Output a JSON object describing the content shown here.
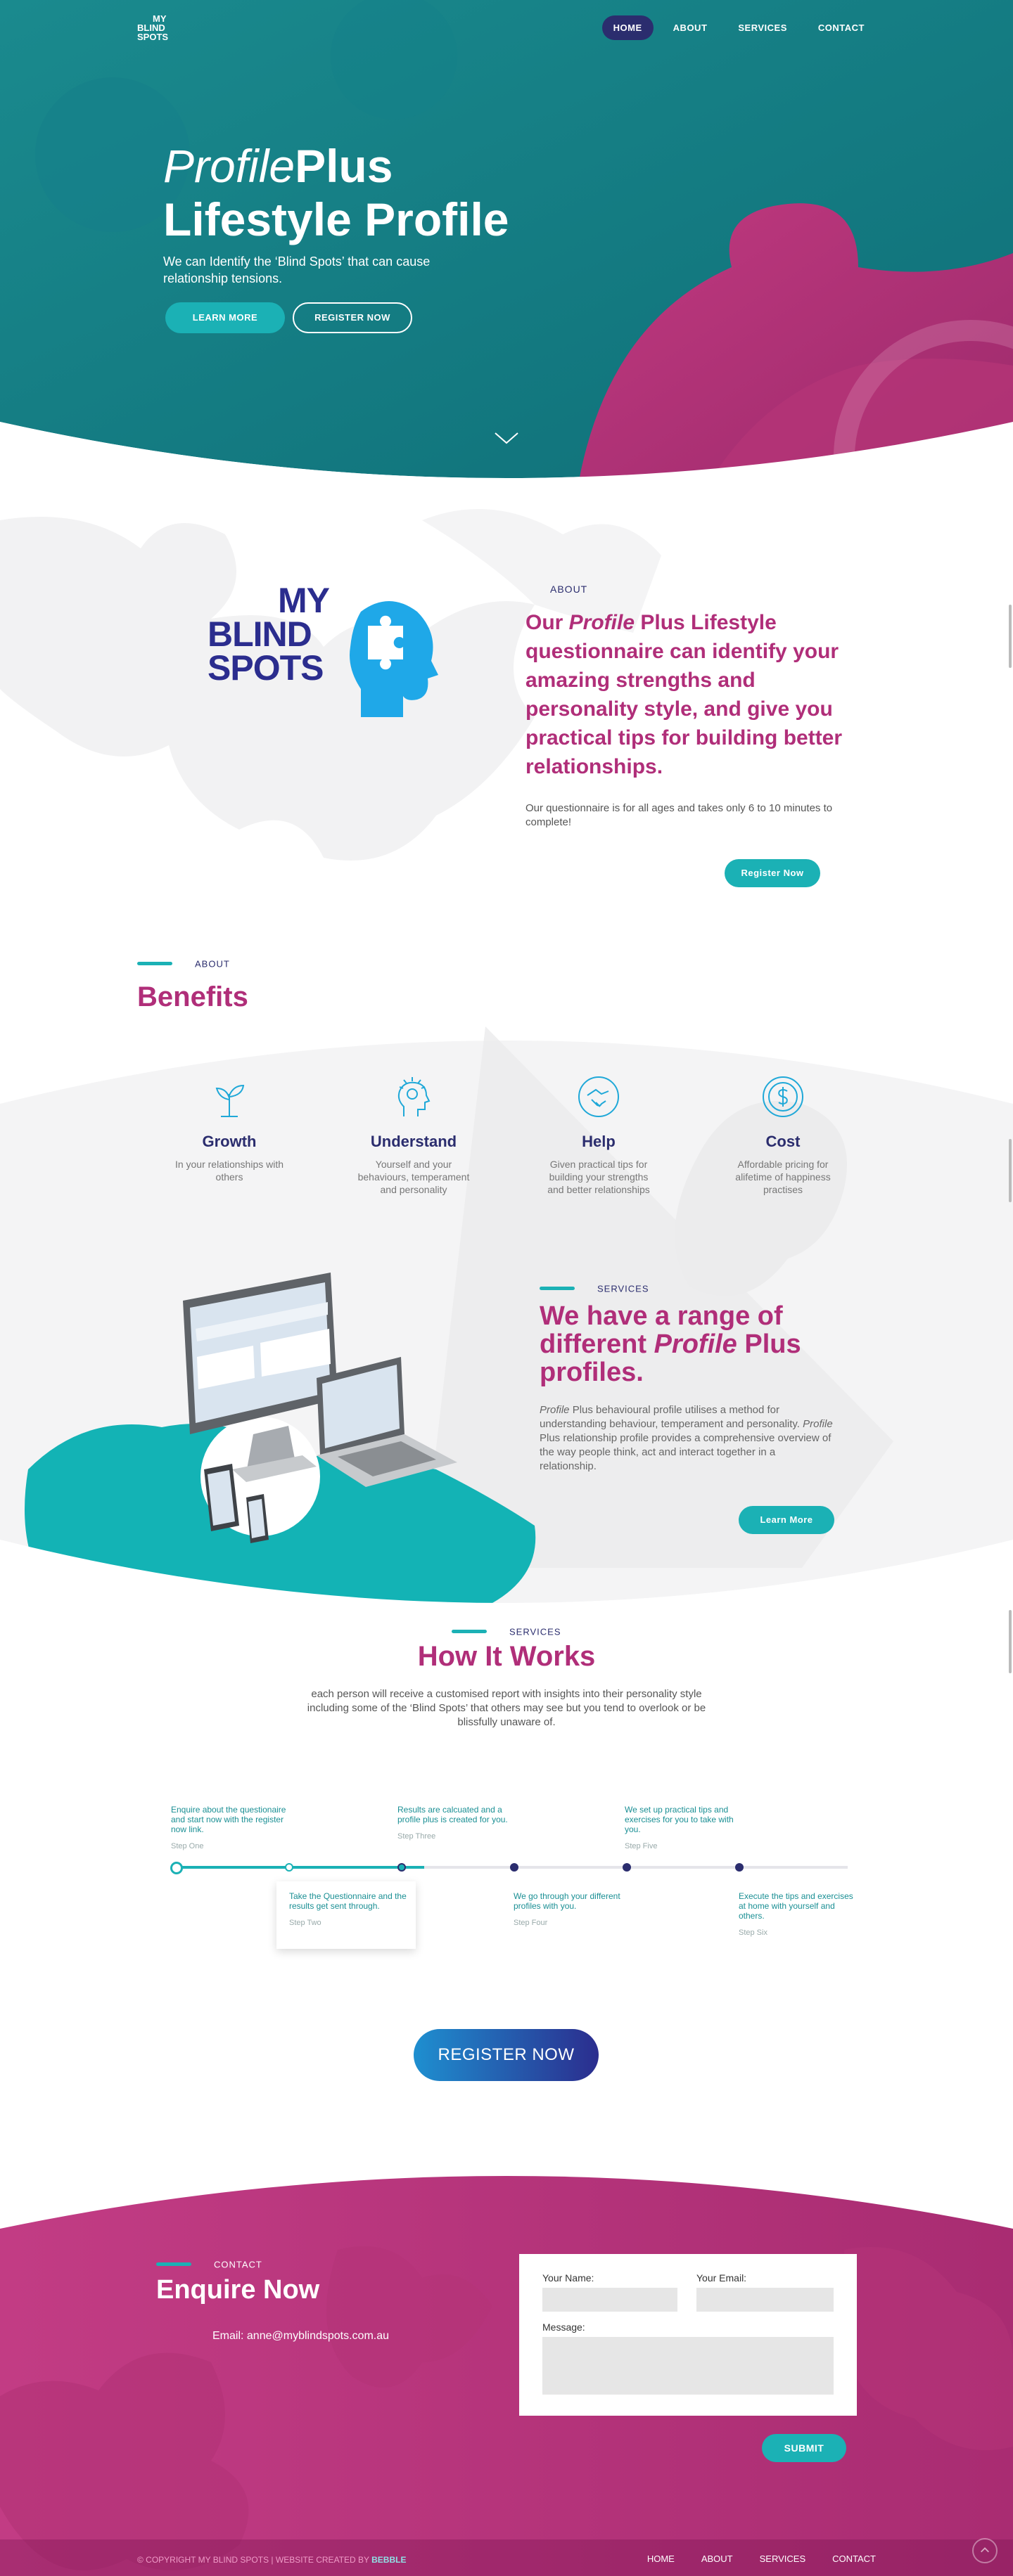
{
  "nav": {
    "logo_lines": [
      "MY",
      "BLIND",
      "SPOTS"
    ],
    "items": [
      "HOME",
      "ABOUT",
      "SERVICES",
      "CONTACT"
    ]
  },
  "hero": {
    "title_italic": "Profile",
    "title_bold": "Plus",
    "title_line2": "Lifestyle Profile",
    "subtitle": "We can Identify the ‘Blind Spots’ that can cause relationship tensions.",
    "learn_more": "LEARN MORE",
    "register": "REGISTER NOW"
  },
  "about": {
    "logo_lines": [
      "MY",
      "BLIND",
      "SPOTS"
    ],
    "kicker": "ABOUT",
    "heading_pre": "Our ",
    "heading_italic": "Profile",
    "heading_post": " Plus Lifestyle questionnaire can identify your amazing strengths and personality style, and give you practical tips for building better relationships.",
    "text": "Our questionnaire is for all ages and takes only 6 to 10 minutes to complete!",
    "button": "Register Now"
  },
  "benefits": {
    "kicker": "ABOUT",
    "title": "Benefits",
    "items": [
      {
        "title": "Growth",
        "desc": "In your relationships with others",
        "icon": "plant-icon"
      },
      {
        "title": "Understand",
        "desc": "Yourself and your behaviours, temperament and personality",
        "icon": "idea-head-icon"
      },
      {
        "title": "Help",
        "desc": "Given practical tips for building your strengths and better relationships",
        "icon": "handshake-icon"
      },
      {
        "title": "Cost",
        "desc": "Affordable pricing for alifetime of happiness practises",
        "icon": "dollar-coin-icon"
      }
    ]
  },
  "services": {
    "kicker": "SERVICES",
    "title_pre": "We have a range of different ",
    "title_italic": "Profile",
    "title_post": " Plus profiles.",
    "text_1_italic": "Profile",
    "text_1": " Plus behavioural profile utilises a method for understanding behaviour, temperament and personality. ",
    "text_2_italic": "Profile",
    "text_2": " Plus relationship profile provides a comprehensive overview of the way people think, act and interact together in a relationship.",
    "button": "Learn More"
  },
  "how": {
    "kicker": "SERVICES",
    "title": "How It Works",
    "text": "each person will receive a customised report with insights into their personality style including some of the ‘Blind Spots’ that others may see but you tend to overlook or be blissfully unaware of.",
    "progress_fraction": 0.37,
    "steps": [
      {
        "text": "Enquire about the questionaire and start now with the register now link.",
        "label": "Step One"
      },
      {
        "text": "Take the Questionnaire and the results get sent through.",
        "label": "Step Two"
      },
      {
        "text": "Results are calcuated and a profile plus is created for you.",
        "label": "Step Three"
      },
      {
        "text": "We go through your different profiles with you.",
        "label": "Step Four"
      },
      {
        "text": "We set up practical tips and exercises for you to take with you.",
        "label": "Step Five"
      },
      {
        "text": "Execute the tips and exercises at home with yourself and others.",
        "label": "Step Six"
      }
    ],
    "register_button": "REGISTER NOW"
  },
  "contact": {
    "kicker": "CONTACT",
    "title": "Enquire Now",
    "email": "Email: anne@myblindspots.com.au",
    "name_label": "Your Name:",
    "email_label": "Your Email:",
    "message_label": "Message:",
    "submit": "SUBMIT"
  },
  "footer": {
    "copyright_pre": "© COPYRIGHT MY BLIND SPOTS | WEBSITE CREATED BY ",
    "copyright_brand": "BEBBLE",
    "menu": [
      "HOME",
      "ABOUT",
      "SERVICES",
      "CONTACT"
    ]
  },
  "colors": {
    "teal": "#1bb1b5",
    "dark_teal": "#137a80",
    "magenta": "#b02e79",
    "navy": "#2b2d6e",
    "logo_blue": "#1fa8e8"
  }
}
